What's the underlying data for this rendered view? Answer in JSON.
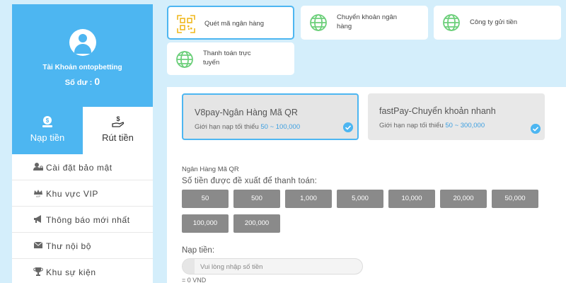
{
  "account": {
    "name": "Tài Khoản ontopbetting",
    "balance_label": "Số dư :",
    "balance_value": "0"
  },
  "tabs": [
    {
      "label": "Nạp tiền",
      "icon": "deposit-coin-icon",
      "active": true
    },
    {
      "label": "Rút tiền",
      "icon": "withdraw-hand-icon",
      "active": false
    }
  ],
  "menu": [
    {
      "label": "Cài đặt bảo mật",
      "icon": "user-lock-icon"
    },
    {
      "label": "Khu vực VIP",
      "icon": "vip-crown-icon"
    },
    {
      "label": "Thông báo mới nhất",
      "icon": "megaphone-icon"
    },
    {
      "label": "Thư nội bộ",
      "icon": "envelope-icon"
    },
    {
      "label": "Khu sự kiện",
      "icon": "trophy-icon"
    }
  ],
  "methods": [
    {
      "label": "Quét mã ngân hàng",
      "icon": "qr-code-icon",
      "active": true
    },
    {
      "label": "Chuyển khoản ngân hàng",
      "icon": "globe-icon",
      "active": false
    },
    {
      "label": "Công ty gửi tiền",
      "icon": "globe-icon",
      "active": false
    },
    {
      "label": "Thanh toán trực tuyến",
      "icon": "globe-icon",
      "active": false
    }
  ],
  "banks": [
    {
      "name": "V8pay-Ngân Hàng Mã QR",
      "limit_prefix": "Giới hạn nạp tối thiểu",
      "limit_range": "50 ~ 100,000",
      "active": true
    },
    {
      "name": "fastPay-Chuyển khoản nhanh",
      "limit_prefix": "Giới hạn nạp tối thiểu",
      "limit_range": "50 ~ 300,000",
      "active": false
    }
  ],
  "deposit": {
    "section_title": "Ngân Hàng Mã QR",
    "suggest_label": "Số tiền được đề xuất để thanh toán:",
    "amounts": [
      "50",
      "500",
      "1,000",
      "5,000",
      "10,000",
      "20,000",
      "50,000",
      "100,000",
      "200,000"
    ],
    "input_label": "Nạp tiền:",
    "input_placeholder": "Vui lòng nhập số tiền",
    "input_value": "",
    "converted": "= 0 VND"
  },
  "colors": {
    "accent": "#4db6f1",
    "background": "#d4eefb",
    "qr_icon": "#f0b81e",
    "globe_icon": "#6ccf7a",
    "amount_button": "#8a8a8a"
  }
}
